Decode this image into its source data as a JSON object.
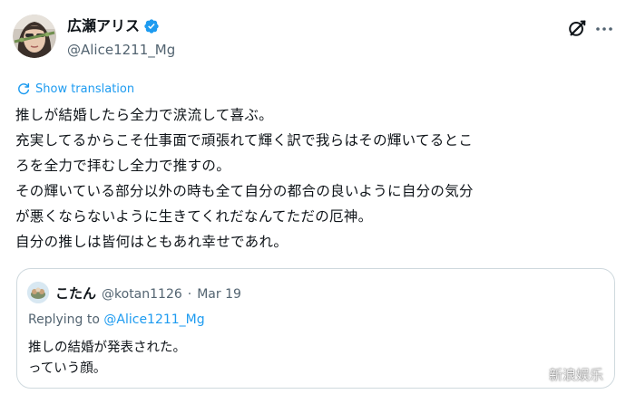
{
  "author": {
    "display_name": "広瀬アリス",
    "handle": "@Alice1211_Mg",
    "verified": true
  },
  "translate_label": "Show translation",
  "body_lines": [
    "推しが結婚したら全力で涙流して喜ぶ。",
    "充実してるからこそ仕事面で頑張れて輝く訳で我らはその輝いてるとこ",
    "ろを全力で拝むし全力で推すの。",
    "その輝いている部分以外の時も全て自分の都合の良いように自分の気分",
    "が悪くならないように生きてくれだなんてただの厄神。",
    "自分の推しは皆何はともあれ幸せであれ。"
  ],
  "quote": {
    "name": "こたん",
    "handle": "@kotan1126",
    "separator": "·",
    "date": "Mar 19",
    "replying_prefix": "Replying to ",
    "replying_handle": "@Alice1211_Mg",
    "lines": [
      "推しの結婚が発表された。",
      "っていう顔。"
    ]
  },
  "watermark": "新浪娱乐",
  "colors": {
    "accent": "#1d9bf0",
    "text": "#0f1419",
    "secondary": "#536471",
    "border": "#cfd9de"
  },
  "icons": {
    "verified": "verified-badge-icon",
    "grok": "grok-icon",
    "more": "more-icon",
    "translate": "translate-icon",
    "watermark": "weibo-logo-icon"
  }
}
